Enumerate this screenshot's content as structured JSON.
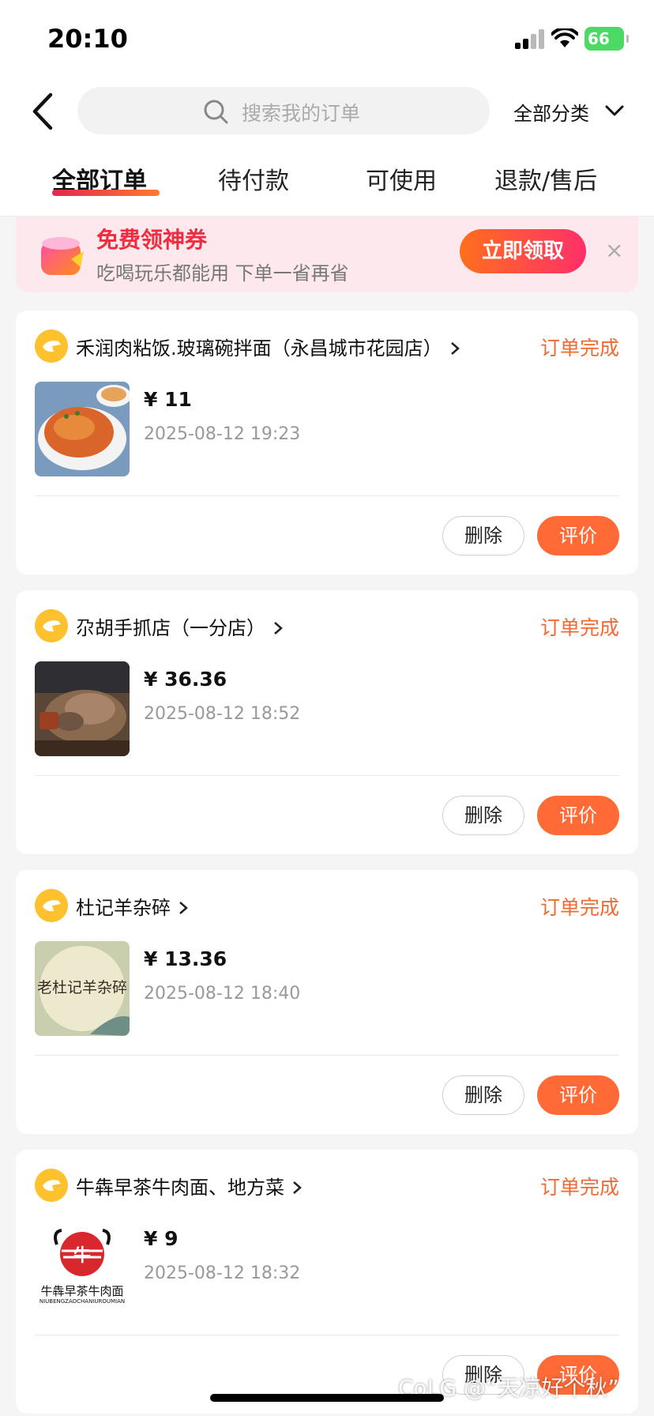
{
  "status_bar": {
    "time": "20:10",
    "battery": "66"
  },
  "header": {
    "search_placeholder": "搜索我的订单",
    "category": "全部分类"
  },
  "tabs": [
    {
      "label": "全部订单",
      "active": true
    },
    {
      "label": "待付款",
      "active": false
    },
    {
      "label": "可使用",
      "active": false
    },
    {
      "label": "退款/售后",
      "active": false
    }
  ],
  "promo": {
    "title": "免费领神券",
    "subtitle": "吃喝玩乐都能用 下单一省再省",
    "button": "立即领取",
    "close": "×"
  },
  "orders": [
    {
      "store": "禾润肉粘饭.玻璃碗拌面（永昌城市花园店）",
      "status": "订单完成",
      "price": "¥ 11",
      "date": "2025-08-12 19:23",
      "delete_label": "删除",
      "rate_label": "评价",
      "thumb": "rice"
    },
    {
      "store": "尕胡手抓店（一分店）",
      "status": "订单完成",
      "price": "¥ 36.36",
      "date": "2025-08-12 18:52",
      "delete_label": "删除",
      "rate_label": "评价",
      "thumb": "meat"
    },
    {
      "store": "杜记羊杂碎",
      "status": "订单完成",
      "price": "¥ 13.36",
      "date": "2025-08-12 18:40",
      "delete_label": "删除",
      "rate_label": "评价",
      "thumb": "logo-du"
    },
    {
      "store": "牛犇早茶牛肉面、地方菜",
      "status": "订单完成",
      "price": "¥ 9",
      "date": "2025-08-12 18:32",
      "delete_label": "删除",
      "rate_label": "评价",
      "thumb": "logo-niu"
    }
  ],
  "thumb_text": {
    "du_logo": "老杜记羊杂碎",
    "niu_logo_char": "牛",
    "niu_logo_name": "牛犇早茶牛肉面",
    "niu_logo_pinyin": "NIUBENGZAOCHANIUROUMIAN"
  },
  "watermark": "CoLG @“天凉好个秋”",
  "colors": {
    "accent": "#ff6a36",
    "status": "#f26a33",
    "promo_red": "#ef2d41",
    "store_icon": "#ffc12e"
  }
}
